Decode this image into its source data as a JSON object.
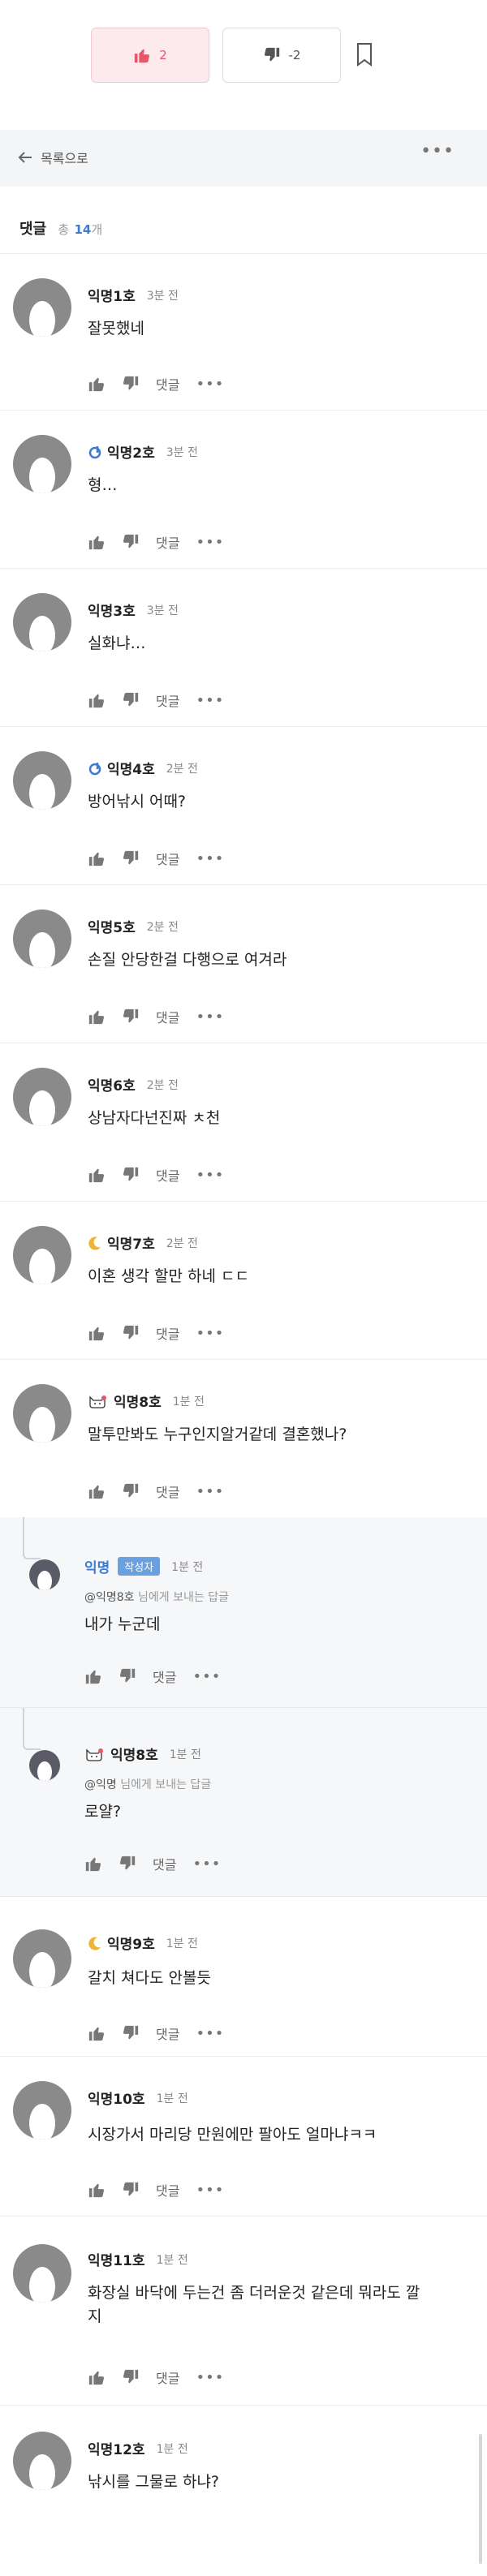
{
  "votes": {
    "up_count": "2",
    "down_count": "-2"
  },
  "toolbar": {
    "back_label": "목록으로",
    "more": "•••"
  },
  "comments_header": {
    "title": "댓글",
    "total_label": "총",
    "count": "14",
    "unit": "개"
  },
  "action_labels": {
    "reply": "댓글",
    "more": "•••"
  },
  "comments": [
    {
      "author": "익명1호",
      "time": "3분 전",
      "content": "잘못했네"
    },
    {
      "author": "익명2호",
      "time": "3분 전",
      "content": "형…",
      "grade": "leaf"
    },
    {
      "author": "익명3호",
      "time": "3분 전",
      "content": "실화냐…"
    },
    {
      "author": "익명4호",
      "time": "2분 전",
      "content": "방어낚시 어때?",
      "grade": "leaf"
    },
    {
      "author": "익명5호",
      "time": "2분 전",
      "content": "손질 안당한걸 다행으로 여겨라"
    },
    {
      "author": "익명6호",
      "time": "2분 전",
      "content": "상남자다넌진짜 ㅊ천"
    },
    {
      "author": "익명7호",
      "time": "2분 전",
      "content": "이혼 생각 할만 하네 ㄷㄷ",
      "grade": "moon"
    },
    {
      "author": "익명8호",
      "time": "1분 전",
      "content": "말투만봐도 누구인지알거같데 결혼했나?",
      "grade": "cat"
    },
    {
      "author": "익명",
      "badge": "작성자",
      "time": "1분 전",
      "reply_target": "@익명8호",
      "reply_suffix": "님에게 보내는 답글",
      "content": "내가 누군데"
    },
    {
      "author": "익명8호",
      "time": "1분 전",
      "reply_target": "@익명",
      "reply_suffix": "님에게 보내는 답글",
      "content": "로얄?",
      "grade": "cat"
    },
    {
      "author": "익명9호",
      "time": "1분 전",
      "content": "갈치 쳐다도 안볼듯",
      "grade": "moon"
    },
    {
      "author": "익명10호",
      "time": "1분 전",
      "content": "시장가서 마리당 만원에만 팔아도 얼마냐ㅋㅋ"
    },
    {
      "author": "익명11호",
      "time": "1분 전",
      "content_line1": "화장실 바닥에 두는건 좀 더러운것 같은데 뭐라도 깔",
      "content_line2": "지"
    },
    {
      "author": "익명12호",
      "time": "1분 전",
      "content": "낚시를 그물로 하냐?"
    }
  ],
  "colors": {
    "accent": "#3a7bd5",
    "upvote": "#e8566a",
    "author_badge": "#6aa0e0"
  },
  "icons": [
    "thumbs-up-icon",
    "thumbs-down-icon",
    "bookmark-icon",
    "arrow-left-icon",
    "more-icon",
    "leaf-grade-icon",
    "moon-grade-icon",
    "cat-grade-icon"
  ]
}
